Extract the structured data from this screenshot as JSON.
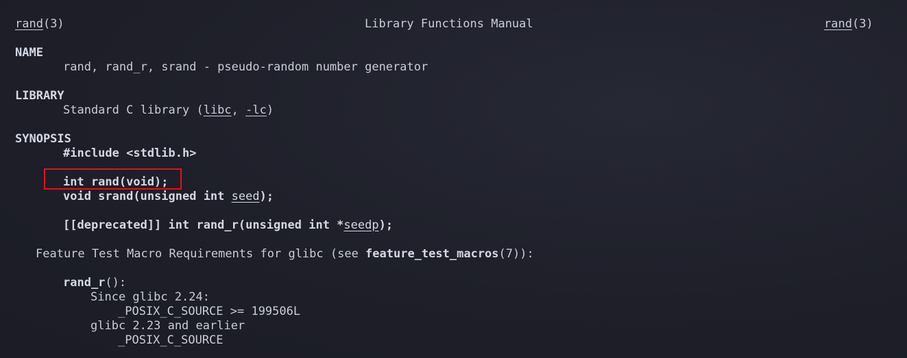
{
  "header": {
    "left_name": "rand",
    "left_section": "(3)",
    "center_title": "Library Functions Manual",
    "right_name": "rand",
    "right_section": "(3)"
  },
  "name_section": {
    "heading": "NAME",
    "text": "rand, rand_r, srand - pseudo-random number generator"
  },
  "library_section": {
    "heading": "LIBRARY",
    "prefix": "Standard C library (",
    "libc": "libc",
    "sep": ", ",
    "lc": "-lc",
    "suffix": ")"
  },
  "synopsis_section": {
    "heading": "SYNOPSIS",
    "include": "#include <stdlib.h>",
    "rand_decl": "int rand(void);",
    "srand_decl_a": "void srand(unsigned int ",
    "srand_param": "seed",
    "srand_decl_b": ");",
    "rand_r_decl_a": "[[deprecated]] int rand_r(unsigned int *",
    "rand_r_param": "seedp",
    "rand_r_decl_b": ");"
  },
  "feature_test": {
    "prefix": "Feature Test Macro Requirements for glibc (see ",
    "link": "feature_test_macros",
    "suffix": "(7)):",
    "func": "rand_r",
    "func_suffix": "():",
    "since": "Since glibc 2.24:",
    "macro_new": "_POSIX_C_SOURCE >= 199506L",
    "older": "glibc 2.23 and earlier",
    "macro_old": "_POSIX_C_SOURCE"
  },
  "highlight": {
    "color": "#e3121b",
    "target": "int rand(void);"
  }
}
